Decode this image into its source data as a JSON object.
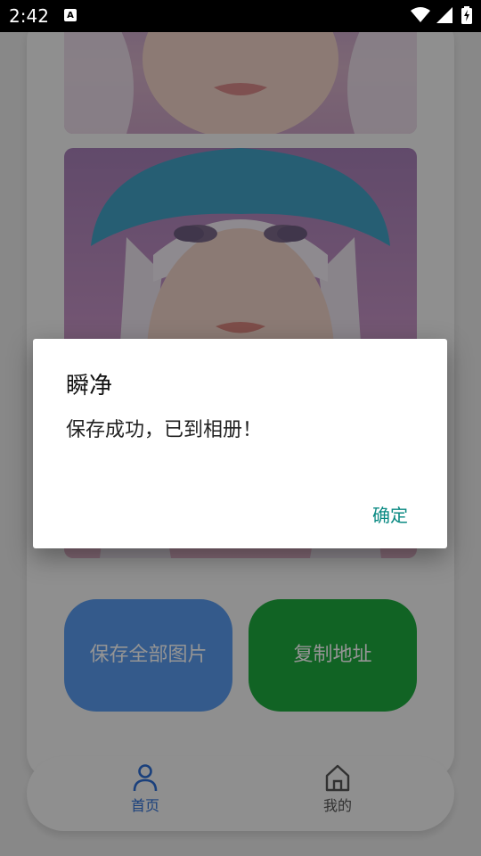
{
  "status_bar": {
    "time": "2:42",
    "badge": "A",
    "icons": [
      "wifi-icon",
      "cell-signal-icon",
      "battery-charging-icon"
    ]
  },
  "actions": {
    "save_all_label": "保存全部图片",
    "copy_address_label": "复制地址"
  },
  "nav": {
    "items": [
      {
        "label": "首页",
        "icon": "person-icon",
        "active": true
      },
      {
        "label": "我的",
        "icon": "home-icon",
        "active": false
      }
    ]
  },
  "dialog": {
    "title": "瞬净",
    "message": "保存成功，已到相册！",
    "ok_label": "确定"
  },
  "colors": {
    "save_button": "#5a9cf0",
    "copy_button": "#1eab3e",
    "nav_active": "#2d6ed6",
    "dialog_ok": "#0b8a83"
  }
}
